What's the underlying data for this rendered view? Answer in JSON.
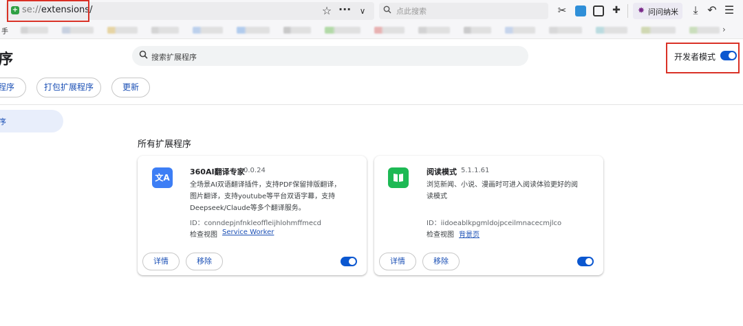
{
  "browser": {
    "url_prefix": "se://",
    "url_path": "extensions/",
    "search_placeholder": "点此搜索",
    "wenwen_label": "问问纳米",
    "bookmark_first": "手",
    "toolbar_icons": [
      "star-icon",
      "more-icon",
      "chevron-down-icon",
      "scissors-icon",
      "image-icon",
      "reader-icon",
      "puzzle-icon",
      "download-icon",
      "undo-icon",
      "menu-icon"
    ],
    "bookmark_colors": [
      "#c8c8c8",
      "#b8c4d8",
      "#e1c988",
      "#c9c9c9",
      "#a9c4e9",
      "#9bbdea",
      "#b9b9b9",
      "#9cd08d",
      "#e39a9a",
      "#c7c7c7",
      "#bcbcbc",
      "#b6c9e8",
      "#cfcfcf",
      "#a7d3d8",
      "#c4cf9c",
      "#bcd7a9"
    ]
  },
  "header": {
    "title": "序",
    "search_placeholder": "搜索扩展程序",
    "dev_mode_label": "开发者模式",
    "dev_mode_on": true
  },
  "actions": {
    "load_label": "程序",
    "pack_label": "打包扩展程序",
    "update_label": "更新"
  },
  "sidebar": {
    "selected_label": "序"
  },
  "section_title": "所有扩展程序",
  "extensions": [
    {
      "name": "360AI翻译专家",
      "version": "0.0.24",
      "desc_lines": [
        "全场景AI双语翻译插件，支持PDF保留排版翻译，",
        "图片翻译，支持youtube等平台双语字幕，支持",
        "Deepseek/Claude等多个翻译服务。"
      ],
      "id_text": "ID：conndepjnfnkleoffleijhlohmffmecd",
      "inspect_label": "检查视图",
      "inspect_link": "Service Worker",
      "details_label": "详情",
      "remove_label": "移除",
      "enabled": true,
      "icon_color": "#3d7ef5",
      "icon_glyph": "文A"
    },
    {
      "name": "阅读模式",
      "version": "5.1.1.61",
      "desc_lines": [
        "浏览新闻、小说、漫画时可进入阅读体验更好的阅",
        "读模式"
      ],
      "id_text": "ID：iidoeablkpgmldojpceilmnacecmjlco",
      "inspect_label": "检查视图",
      "inspect_link": "背景页",
      "details_label": "详情",
      "remove_label": "移除",
      "enabled": true,
      "icon_color": "#1db954",
      "icon_glyph": "📖"
    }
  ],
  "colors": {
    "accent": "#0b57d0",
    "highlight": "#d93025"
  }
}
